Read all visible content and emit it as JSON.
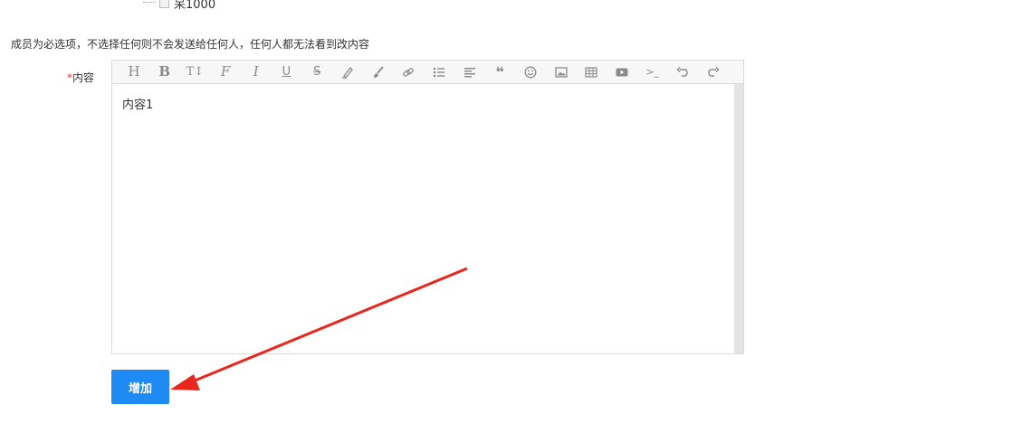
{
  "tree": {
    "item_label": "呆1000"
  },
  "notice_text": "成员为必选项，不选择任何则不会发送给任何人，任何人都无法看到改内容",
  "content_field": {
    "required_mark": "*",
    "label": "内容",
    "value": "内容1"
  },
  "toolbar_icons": [
    "heading-icon",
    "bold-icon",
    "text-size-icon",
    "font-icon",
    "italic-icon",
    "underline-icon",
    "strikethrough-icon",
    "highlight-icon",
    "brush-icon",
    "link-icon",
    "unordered-list-icon",
    "align-left-icon",
    "quote-icon",
    "emoji-icon",
    "image-icon",
    "table-icon",
    "video-icon",
    "code-icon",
    "undo-icon",
    "redo-icon"
  ],
  "submit_button": {
    "label": "增加",
    "color": "#1e8bf5"
  },
  "annotation_arrow_color": "#e8261c"
}
